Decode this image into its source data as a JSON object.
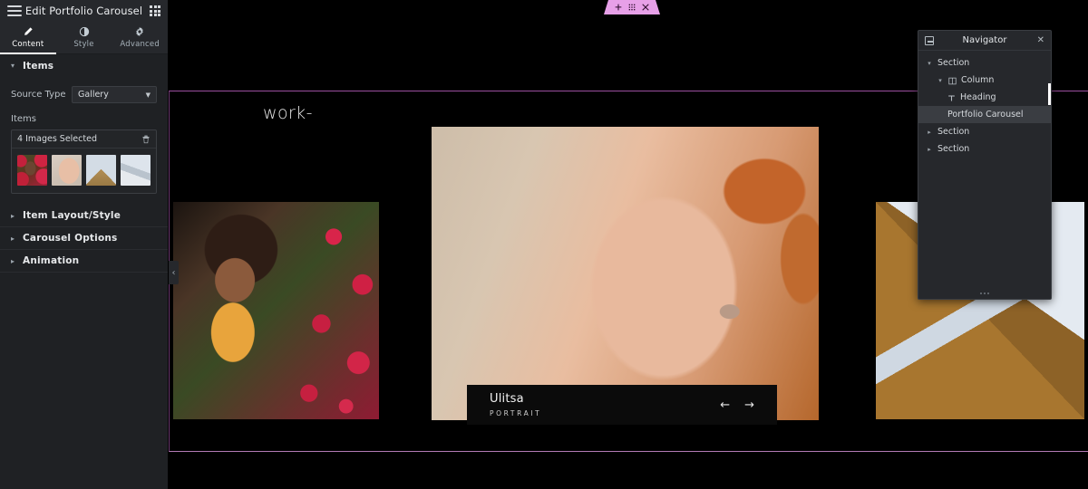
{
  "window": {
    "title": "Edit Portfolio Carousel",
    "menu_icon": "hamburger-icon",
    "apps_icon": "apps-grid-icon"
  },
  "tabs": [
    {
      "label": "Content",
      "icon": "pencil-icon",
      "active": true
    },
    {
      "label": "Style",
      "icon": "contrast-icon",
      "active": false
    },
    {
      "label": "Advanced",
      "icon": "gear-icon",
      "active": false
    }
  ],
  "panel": {
    "items_section": {
      "title": "Items",
      "source_type_label": "Source Type",
      "source_type_value": "Gallery",
      "items_label": "Items",
      "gallery_value": "4 Images Selected",
      "trash_icon": "trash-icon",
      "thumbnails": [
        {
          "name": "thumb-flowers-portrait"
        },
        {
          "name": "thumb-face-profile"
        },
        {
          "name": "thumb-pyramid"
        },
        {
          "name": "thumb-architecture"
        }
      ]
    },
    "collapsed_sections": [
      {
        "title": "Item Layout/Style"
      },
      {
        "title": "Carousel Options"
      },
      {
        "title": "Animation"
      }
    ],
    "collapse_handle": "‹"
  },
  "canvas": {
    "section_toolbar": {
      "add_icon": "plus-icon",
      "drag_icon": "drag-handle-icon",
      "remove_icon": "close-icon"
    },
    "heading": "work-",
    "caption": {
      "title": "Ulitsa",
      "subtitle": "PORTRAIT",
      "prev_icon": "arrow-left-icon",
      "next_icon": "arrow-right-icon",
      "prev_glyph": "←",
      "next_glyph": "→"
    },
    "slides": [
      {
        "name": "slide-flowers"
      },
      {
        "name": "slide-portrait"
      },
      {
        "name": "slide-architecture"
      }
    ]
  },
  "navigator": {
    "title": "Navigator",
    "dock_icon": "dock-icon",
    "close_icon": "close-icon",
    "tree": [
      {
        "label": "Section",
        "depth": 0,
        "caret": "▾",
        "icon": null,
        "selected": false
      },
      {
        "label": "Column",
        "depth": 1,
        "caret": "▾",
        "icon": "column-icon",
        "selected": false
      },
      {
        "label": "Heading",
        "depth": 2,
        "caret": "",
        "icon": "heading-icon",
        "selected": false
      },
      {
        "label": "Portfolio Carousel",
        "depth": 2,
        "caret": "",
        "icon": null,
        "selected": true
      },
      {
        "label": "Section",
        "depth": 0,
        "caret": "▸",
        "icon": null,
        "selected": false
      },
      {
        "label": "Section",
        "depth": 0,
        "caret": "▸",
        "icon": null,
        "selected": false
      }
    ]
  },
  "colors": {
    "panel_bg": "#1f2124",
    "header_bg": "#26282c",
    "accent_pink": "#e7a0e8",
    "section_outline": "#9b4f9e",
    "canvas_bg": "#000000"
  }
}
